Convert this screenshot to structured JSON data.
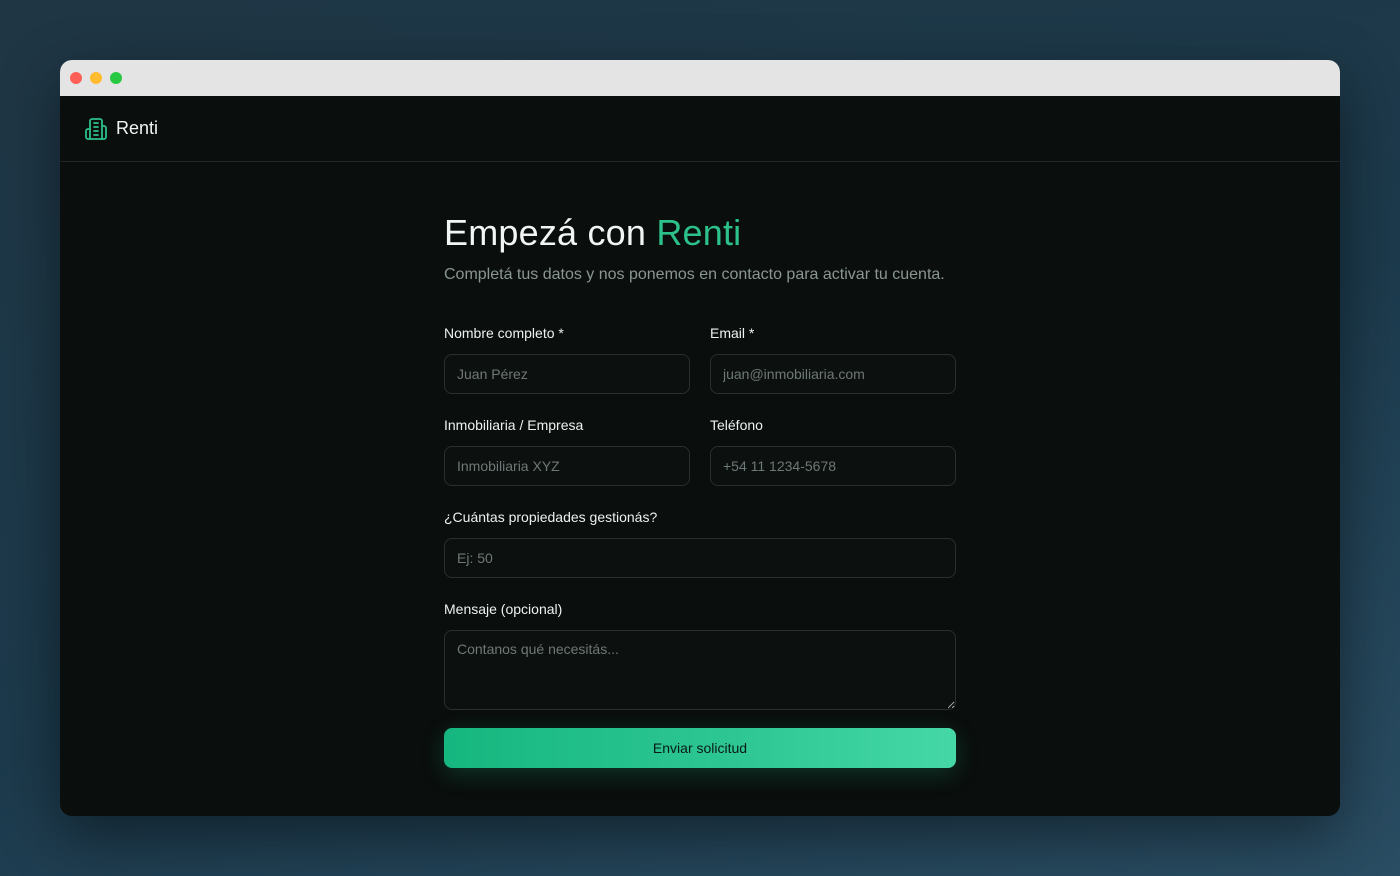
{
  "window": {
    "controls": [
      "close",
      "minimize",
      "maximize"
    ]
  },
  "navbar": {
    "brand": "Renti",
    "logo_icon": "building-icon",
    "accent_color": "#2cc18a"
  },
  "hero": {
    "title_prefix": "Empezá con",
    "title_accent": "Renti",
    "subtitle": "Completá tus datos y nos ponemos en contacto para activar tu cuenta."
  },
  "form": {
    "name": {
      "label": "Nombre completo *",
      "placeholder": "Juan Pérez",
      "value": ""
    },
    "email": {
      "label": "Email *",
      "placeholder": "juan@inmobiliaria.com",
      "value": ""
    },
    "company": {
      "label": "Inmobiliaria / Empresa",
      "placeholder": "Inmobiliaria XYZ",
      "value": ""
    },
    "phone": {
      "label": "Teléfono",
      "placeholder": "+54 11 1234-5678",
      "value": ""
    },
    "properties": {
      "label": "¿Cuántas propiedades gestionás?",
      "placeholder": "Ej: 50",
      "value": ""
    },
    "message": {
      "label": "Mensaje (opcional)",
      "placeholder": "Contanos qué necesitás...",
      "value": ""
    },
    "submit_label": "Enviar solicitud"
  }
}
